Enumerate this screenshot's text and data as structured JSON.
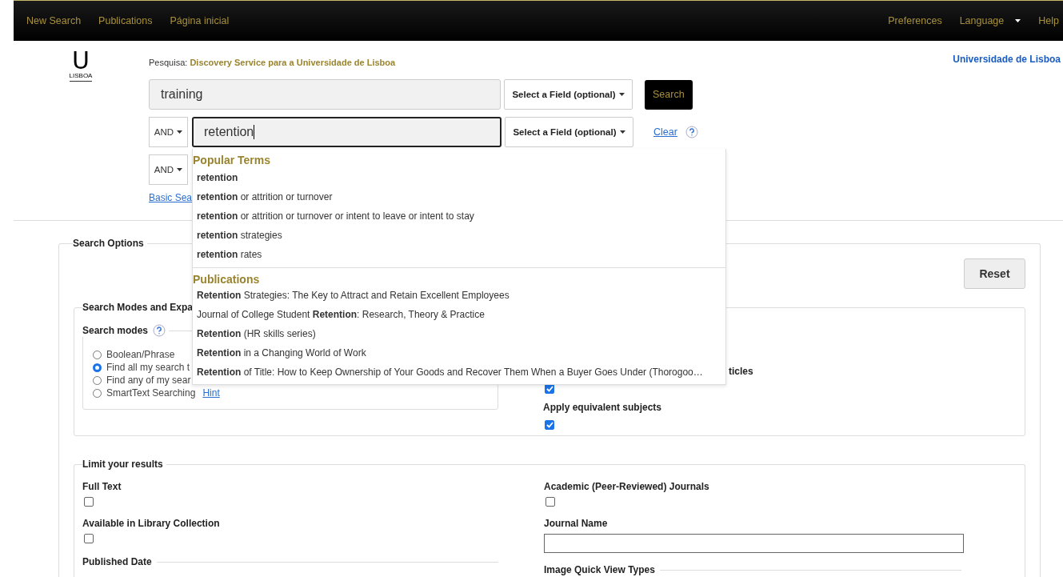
{
  "nav": {
    "left": [
      {
        "label": "New Search"
      },
      {
        "label": "Publications"
      },
      {
        "label": "Página inicial"
      }
    ],
    "right": [
      {
        "label": "Preferences",
        "kind": "link"
      },
      {
        "label": "Language",
        "kind": "menu"
      },
      {
        "label": "Help",
        "kind": "link"
      }
    ]
  },
  "logo": {
    "mark": "U",
    "name": "LISBOA"
  },
  "header": {
    "prefix": "Pesquisa:",
    "service": "Discovery Service para a Universidade de Lisboa",
    "institution": "Universidade de Lisboa"
  },
  "search_rows": [
    {
      "operator": null,
      "value": "training",
      "field": "Select a Field (optional)",
      "focused": false,
      "kind": "first"
    },
    {
      "operator": "AND",
      "value": "retention",
      "field": "Select a Field (optional)",
      "focused": true,
      "kind": "clear"
    },
    {
      "operator": "AND",
      "kind": "plain"
    }
  ],
  "search_button": "Search",
  "clear_link": "Clear",
  "basic_search_link": "Basic Sea",
  "suggestions": [
    {
      "heading": "Popular Terms",
      "items": [
        "**retention**",
        "**retention** or attrition or turnover",
        "**retention** or attrition or turnover or intent to leave or intent to stay",
        "**retention** strategies",
        "**retention** rates"
      ]
    },
    {
      "heading": "Publications",
      "items": [
        "**Retention** Strategies: The Key to Attract and Retain Excellent Employees",
        "Journal of College Student **Retention**: Research, Theory & Practice",
        "**Retention** (HR skills series)",
        "**Retention** in a Changing World of Work",
        "**Retention** of Title: How to Keep Ownership of Your Goods and Recover Them When a Buyer Goes Under (Thorogoo…"
      ]
    }
  ],
  "search_options": {
    "legend": "Search Options",
    "reset": "Reset",
    "modes_section": "Search Modes and Expa",
    "modes_legend": "Search modes",
    "modes": [
      {
        "label": "Boolean/Phrase",
        "selected": false
      },
      {
        "label": "Find all my search t",
        "selected": true
      },
      {
        "label": "Find any of my sear",
        "selected": false
      },
      {
        "label": "SmartText Searching",
        "selected": false,
        "link": "Hint"
      }
    ],
    "expanders": [
      {
        "label": "ticles",
        "checked": true,
        "kind": "cut"
      },
      {
        "label": "Apply equivalent subjects",
        "checked": true,
        "kind": "full"
      }
    ]
  },
  "limits": {
    "legend": "Limit your results",
    "left": [
      {
        "label": "Full Text",
        "checked": false,
        "kind": "checkbox"
      },
      {
        "label": "Available in Library Collection",
        "checked": false,
        "kind": "checkbox"
      },
      {
        "label": "Published Date",
        "kind": "group"
      }
    ],
    "right": [
      {
        "label": "Academic (Peer-Reviewed) Journals",
        "checked": false,
        "kind": "checkbox"
      },
      {
        "label": "Journal Name",
        "kind": "text"
      },
      {
        "label": "Image Quick View Types",
        "kind": "group"
      }
    ]
  }
}
